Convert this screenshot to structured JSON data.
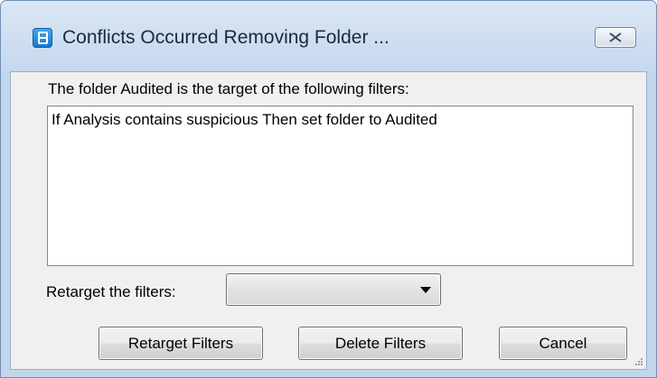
{
  "window": {
    "title": "Conflicts Occurred Removing Folder ...",
    "app_icon": "app-document-icon",
    "close_icon": "close-icon"
  },
  "dialog": {
    "prompt": "The folder Audited is the target of the following filters:",
    "filters": [
      "If Analysis contains suspicious Then set folder to Audited"
    ],
    "retarget_label": "Retarget the filters:",
    "retarget_selected": "",
    "buttons": {
      "retarget": "Retarget Filters",
      "delete": "Delete Filters",
      "cancel": "Cancel"
    }
  },
  "colors": {
    "title_bar": "#c5d8ee",
    "client_area": "#f0f0f0",
    "list_background": "#ffffff"
  }
}
